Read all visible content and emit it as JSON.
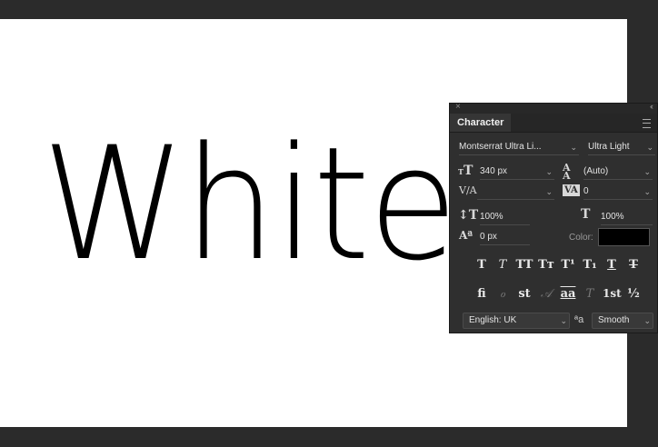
{
  "canvas": {
    "text": "White"
  },
  "panel": {
    "tab_title": "Character",
    "close_symbol": "×",
    "collapse_symbol": "‹‹",
    "font_family": "Montserrat Ultra Li...",
    "font_style": "Ultra Light",
    "font_size": "340 px",
    "leading": "(Auto)",
    "kerning": "",
    "tracking": "0",
    "vertical_scale": "100%",
    "horizontal_scale": "100%",
    "baseline_shift": "0 px",
    "color_label": "Color:",
    "color_value": "#000000",
    "language": "English: UK",
    "antialias": "Smooth",
    "antialias_icon_text": "ªa",
    "style_buttons": [
      "T",
      "T",
      "TT",
      "Tт",
      "T¹",
      "T₁",
      "T",
      "T"
    ],
    "opentype_buttons": [
      "fi",
      "ℴ",
      "st",
      "𝒜",
      "aa",
      "T",
      "1st",
      "½"
    ],
    "icons": {
      "font_size": "tT",
      "leading": "A/A",
      "kerning": "V/A",
      "tracking": "VA",
      "vertical_scale": "↕T",
      "horizontal_scale": "T↔",
      "baseline_shift": "Aª"
    }
  }
}
